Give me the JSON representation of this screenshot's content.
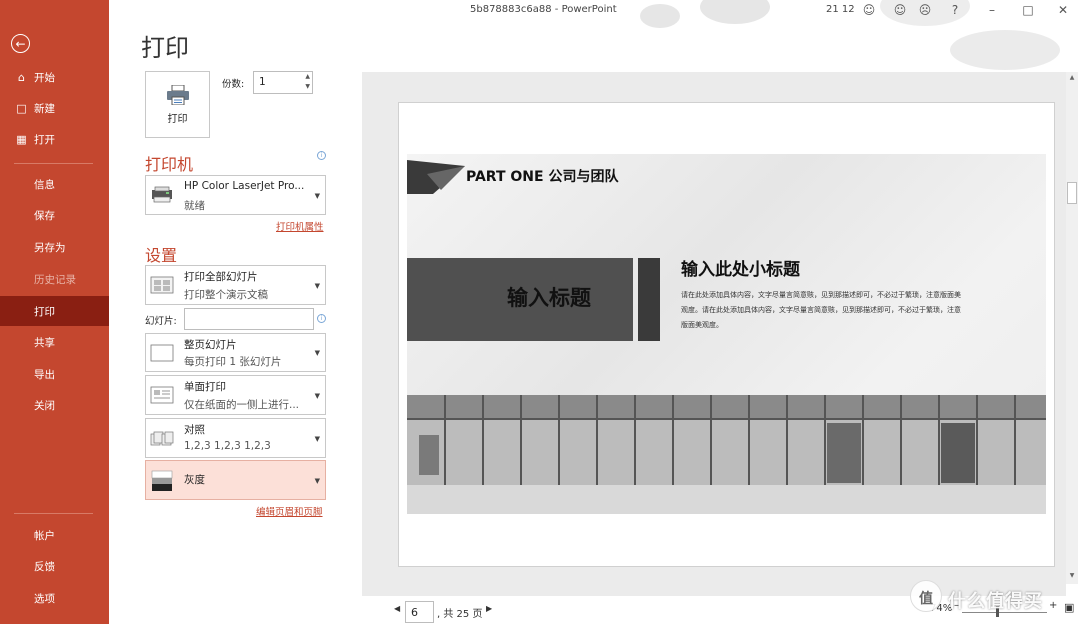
{
  "window": {
    "title": "5b878883c6a88  -  PowerPoint",
    "time": "21 12"
  },
  "nav": {
    "back_icon": "back-arrow-icon",
    "items": [
      {
        "label": "开始",
        "icon": "home-icon"
      },
      {
        "label": "新建",
        "icon": "new-document-icon"
      },
      {
        "label": "打开",
        "icon": "open-folder-icon"
      },
      {
        "label": "信息"
      },
      {
        "label": "保存"
      },
      {
        "label": "另存为"
      },
      {
        "label": "历史记录"
      },
      {
        "label": "打印"
      },
      {
        "label": "共享"
      },
      {
        "label": "导出"
      },
      {
        "label": "关闭"
      },
      {
        "label": "帐户"
      },
      {
        "label": "反馈"
      },
      {
        "label": "选项"
      }
    ],
    "active_color": "#8a1f12",
    "bg_color": "#c4472f"
  },
  "page": {
    "title": "打印",
    "print_button": "打印",
    "copies_label": "份数:",
    "copies_value": "1"
  },
  "printer": {
    "header": "打印机",
    "name": "HP Color LaserJet Pro...",
    "status": "就绪",
    "properties_link": "打印机属性"
  },
  "settings": {
    "header": "设置",
    "range_title": "打印全部幻灯片",
    "range_desc": "打印整个演示文稿",
    "slides_label": "幻灯片:",
    "slides_value": "",
    "layout_title": "整页幻灯片",
    "layout_desc": "每页打印 1 张幻灯片",
    "sides_title": "单面打印",
    "sides_desc": "仅在纸面的一侧上进行...",
    "collate_title": "对照",
    "collate_desc": "1,2,3    1,2,3    1,2,3",
    "color_title": "灰度",
    "header_footer_link": "编辑页眉和页脚"
  },
  "preview": {
    "part_one": "PART ONE 公司与团队",
    "slide_title": "输入标题",
    "slide_subtitle": "输入此处小标题",
    "slide_body": "请在此处添加具体内容，文字尽量言简意赅，见到那描述即可，不必过于繁琐，注意版面美观度。请在此处添加具体内容，文字尽量言简意赅，见到那描述即可，不必过于繁琐，注意版面美观度。"
  },
  "pager": {
    "current_page": "6",
    "total": ", 共 25 页",
    "zoom": "74%"
  },
  "watermark": {
    "text": "什么值得买",
    "glyph": "值"
  }
}
